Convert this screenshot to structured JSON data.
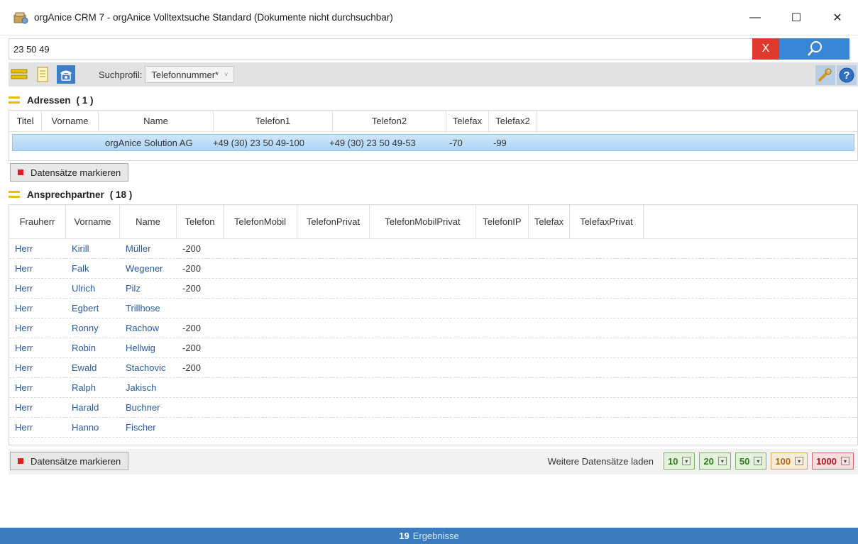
{
  "window": {
    "title": "orgAnice CRM 7 - orgAnice Volltextsuche Standard (Dokumente nicht durchsuchbar)",
    "minimize": "—",
    "maximize": "☐",
    "close": "✕"
  },
  "search": {
    "value": "23 50 49",
    "clear_label": "X",
    "search_icon": "search-icon"
  },
  "toolbar": {
    "profile_label": "Suchprofil:",
    "profile_value": "Telefonnummer*",
    "profile_chevron": "˅"
  },
  "addresses": {
    "title": "Adressen",
    "count": "( 1 )",
    "columns": [
      "Titel",
      "Vorname",
      "Name",
      "Telefon1",
      "Telefon2",
      "Telefax",
      "Telefax2"
    ],
    "rows": [
      [
        "",
        "",
        "orgAnice Solution AG",
        "+49 (30) 23 50 49-100",
        "+49 (30) 23 50 49-53",
        "-70",
        "-99"
      ]
    ]
  },
  "mark_button_label": "Datensätze markieren",
  "contacts": {
    "title": "Ansprechpartner",
    "count": "( 18 )",
    "columns": [
      "Frauherr",
      "Vorname",
      "Name",
      "Telefon",
      "TelefonMobil",
      "TelefonPrivat",
      "TelefonMobilPrivat",
      "TelefonIP",
      "Telefax",
      "TelefaxPrivat"
    ],
    "rows": [
      [
        "Herr",
        "Kirill",
        "Müller",
        "-200"
      ],
      [
        "Herr",
        "Falk",
        "Wegener",
        "-200"
      ],
      [
        "Herr",
        "Ulrich",
        "Pilz",
        "-200"
      ],
      [
        "Herr",
        "Egbert",
        "Trillhose",
        ""
      ],
      [
        "Herr",
        "Ronny",
        "Rachow",
        "-200"
      ],
      [
        "Herr",
        "Robin",
        "Hellwig",
        "-200"
      ],
      [
        "Herr",
        "Ewald",
        "Stachovic",
        "-200"
      ],
      [
        "Herr",
        "Ralph",
        "Jakisch",
        ""
      ],
      [
        "Herr",
        "Harald",
        "Buchner",
        ""
      ],
      [
        "Herr",
        "Hanno",
        "Fischer",
        ""
      ]
    ]
  },
  "load_more": {
    "label": "Weitere Datensätze laden",
    "options": [
      {
        "value": "10",
        "color": "#2e7d1a",
        "bg": "#e4f2dc",
        "border": "#7ab55c"
      },
      {
        "value": "20",
        "color": "#2e7d1a",
        "bg": "#e4f2dc",
        "border": "#7ab55c"
      },
      {
        "value": "50",
        "color": "#2e7d1a",
        "bg": "#e4f2dc",
        "border": "#7ab55c"
      },
      {
        "value": "100",
        "color": "#b06a10",
        "bg": "#f6ecd9",
        "border": "#d1a55c"
      },
      {
        "value": "1000",
        "color": "#b01818",
        "bg": "#f6dede",
        "border": "#cc6b6b"
      }
    ]
  },
  "status": {
    "count": "19",
    "label": "Ergebnisse"
  },
  "colors": {
    "accent": "#3a7bbd",
    "clear": "#e03a2f",
    "section_icon": "#e8c000",
    "selected_row": "#aed6f6"
  }
}
